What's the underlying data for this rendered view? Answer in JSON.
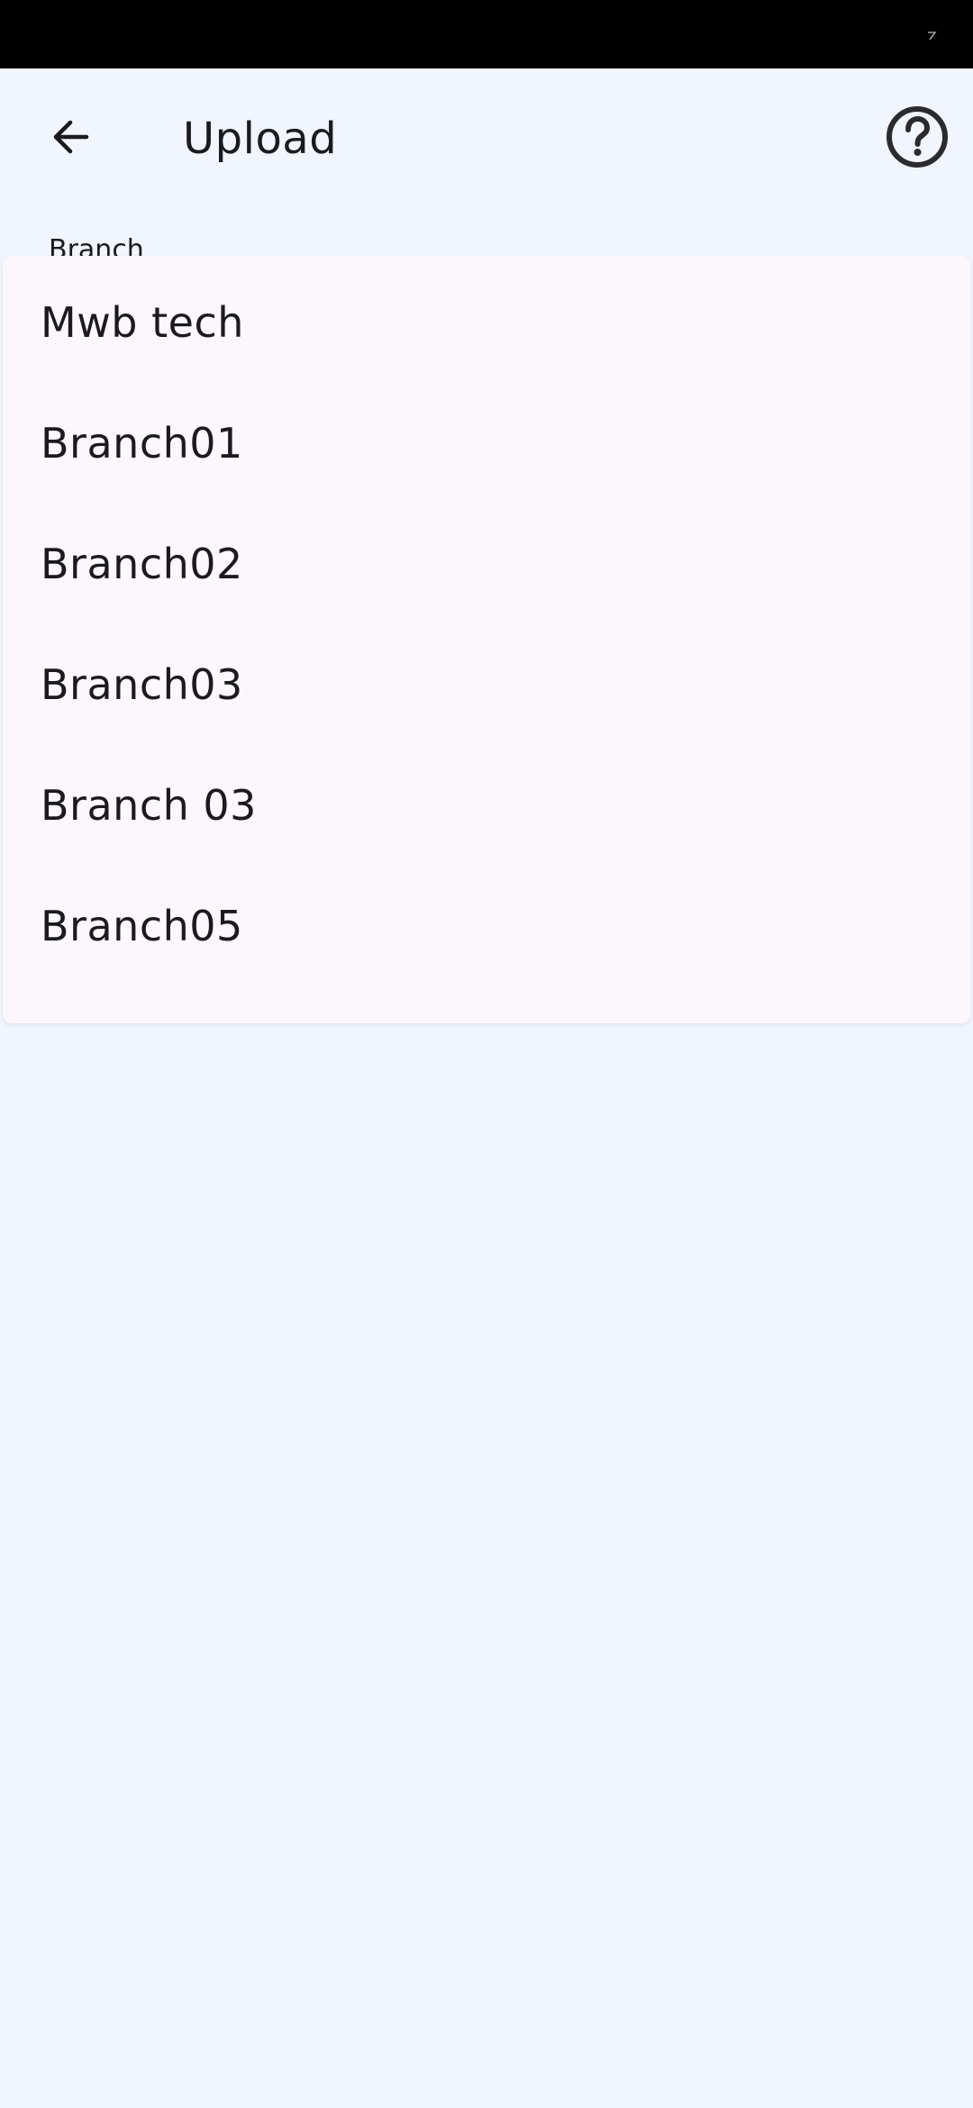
{
  "header": {
    "title": "Upload"
  },
  "icons": {
    "back": "arrow-back-icon",
    "help": "help-circle-icon"
  },
  "form": {
    "branch_label": "Branch"
  },
  "dropdown": {
    "options": [
      "Mwb tech",
      "Branch01",
      "Branch02",
      "Branch03",
      "Branch 03",
      "Branch05"
    ]
  },
  "colors": {
    "background": "#f1f5fe",
    "status_bar": "#000000",
    "menu_surface": "#fcf7fc",
    "text": "#1b1b1f"
  }
}
